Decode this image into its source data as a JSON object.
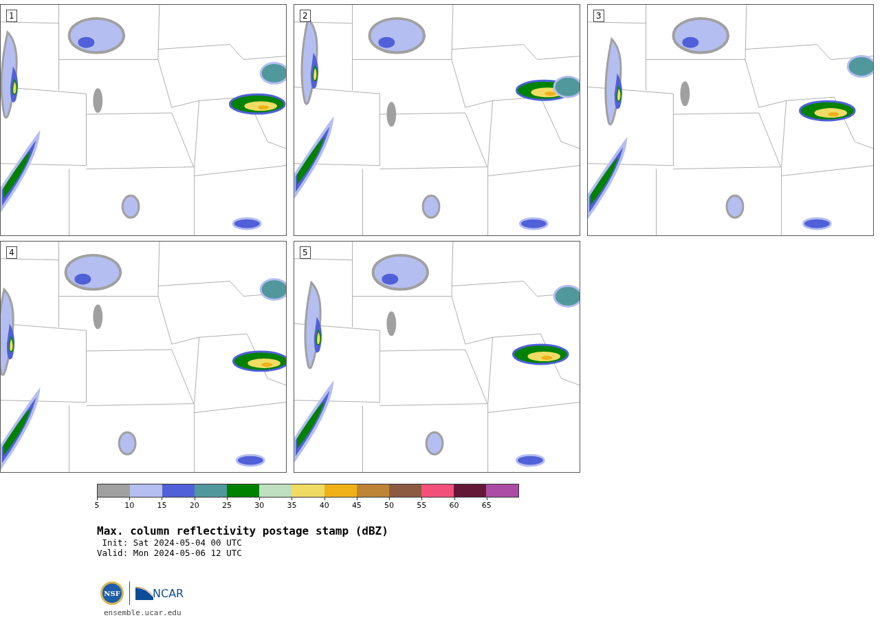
{
  "panels": [
    {
      "label": "1"
    },
    {
      "label": "2"
    },
    {
      "label": "3"
    },
    {
      "label": "4"
    },
    {
      "label": "5"
    }
  ],
  "colorbar": {
    "segments": [
      {
        "color": "#a0a0a0",
        "tick": "5"
      },
      {
        "color": "#b4bef0",
        "tick": "10"
      },
      {
        "color": "#5060d8",
        "tick": "15"
      },
      {
        "color": "#50989c",
        "tick": "20"
      },
      {
        "color": "#008200",
        "tick": "25"
      },
      {
        "color": "#bee0c0",
        "tick": "30"
      },
      {
        "color": "#f0dc64",
        "tick": "35"
      },
      {
        "color": "#f0b018",
        "tick": "40"
      },
      {
        "color": "#bc8434",
        "tick": "45"
      },
      {
        "color": "#8c5a40",
        "tick": "50"
      },
      {
        "color": "#f4507c",
        "tick": "55"
      },
      {
        "color": "#641838",
        "tick": "60"
      },
      {
        "color": "#ac4ca4",
        "tick": "65"
      }
    ]
  },
  "title": "Max. column reflectivity postage stamp (dBZ)",
  "init": " Init: Sat 2024-05-04 00 UTC",
  "valid": "Valid: Mon 2024-05-06 12 UTC",
  "logos": {
    "nsf": "NSF",
    "ncar": "NCAR"
  },
  "footer": "ensemble.ucar.edu"
}
